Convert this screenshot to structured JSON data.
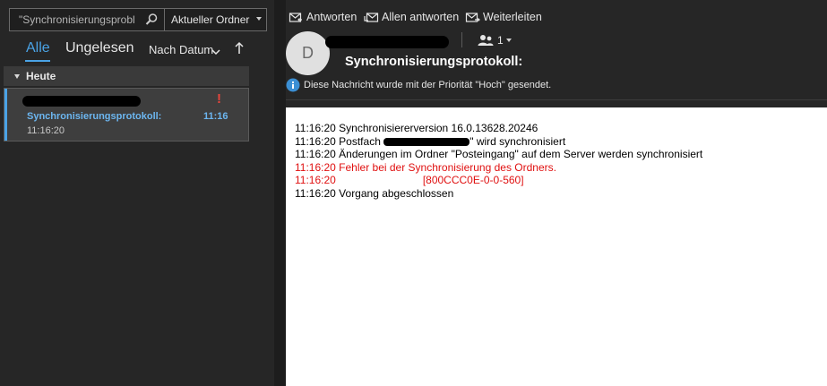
{
  "search": {
    "value": "\"Synchronisierungsprobl",
    "scope": "Aktueller Ordner",
    "icon": "search-icon"
  },
  "filters": {
    "all_label": "Alle",
    "unread_label": "Ungelesen",
    "sort_label": "Nach Datum",
    "sort_direction": "↑"
  },
  "list": {
    "group_label": "Heute",
    "items": [
      {
        "priority": "!",
        "subject": "Synchronisierungsprotokoll:",
        "time": "11:16",
        "preview": "11:16:20"
      }
    ]
  },
  "toolbar": {
    "reply": "Antworten",
    "reply_all": "Allen antworten",
    "forward": "Weiterleiten"
  },
  "message": {
    "avatar_initial": "D",
    "recipients_count": "1",
    "title": "Synchronisierungsprotokoll:",
    "info": "Diese Nachricht wurde mit der Priorität \"Hoch\" gesendet.",
    "log": [
      {
        "time": "11:16:20",
        "text": "Synchronisiererversion 16.0.13628.20246"
      },
      {
        "time": "11:16:20",
        "text_before": "Postfach",
        "text_after": "\" wird synchronisiert"
      },
      {
        "time": "11:16:20",
        "text": "Änderungen im Ordner \"Posteingang\" auf dem Server werden synchronisiert"
      },
      {
        "time": "11:16:20",
        "text": "Fehler bei der Synchronisierung des Ordners."
      },
      {
        "time": "11:16:20",
        "text": "[800CCC0E-0-0-560]"
      },
      {
        "time": "11:16:20",
        "text": "Vorgang abgeschlossen"
      }
    ]
  },
  "colors": {
    "accent": "#4aa3e6",
    "error": "#e01010",
    "priority": "#e8453c",
    "background": "#262626"
  }
}
